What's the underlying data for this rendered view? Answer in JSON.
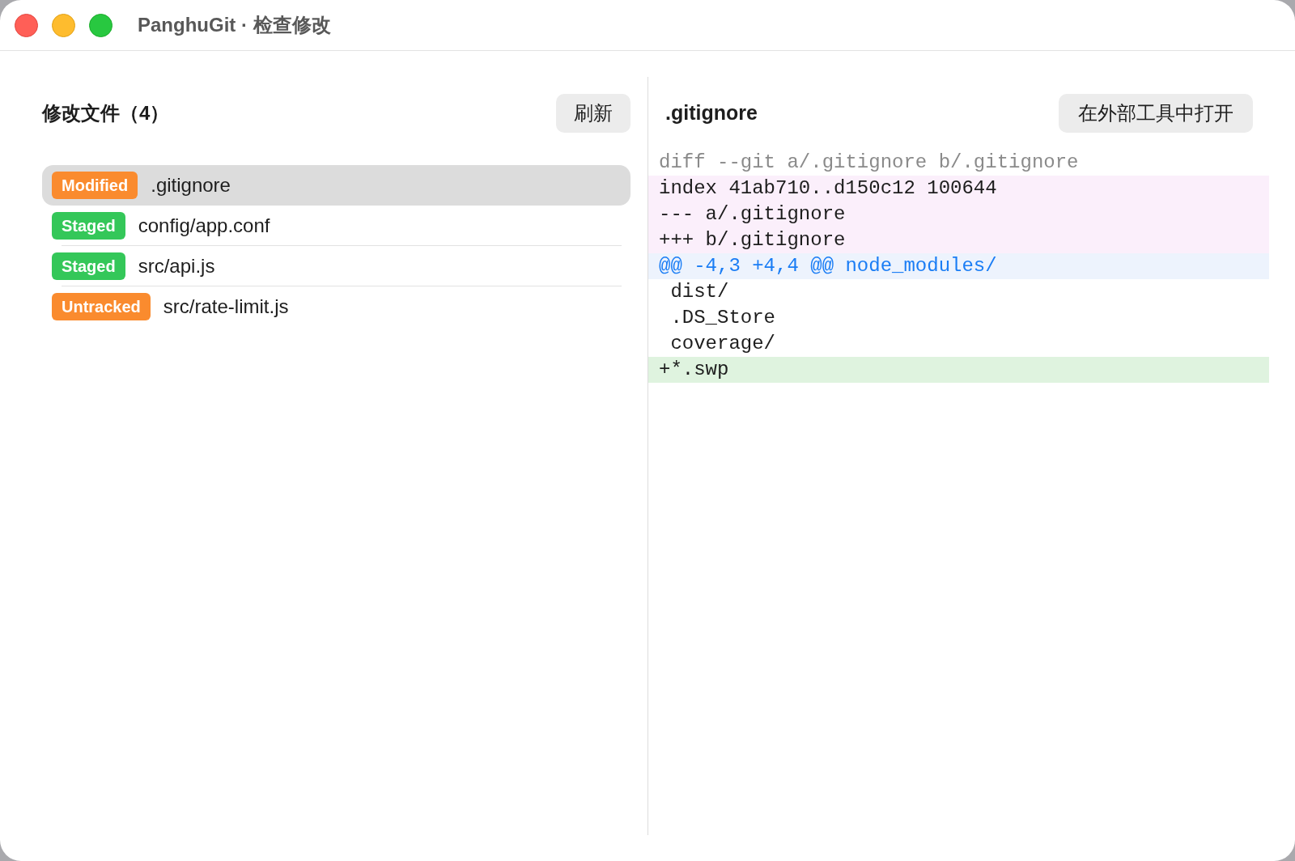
{
  "window": {
    "title": "PanghuGit · 检查修改"
  },
  "file_list": {
    "title": "修改文件（4）",
    "refresh_button": "刷新",
    "items": [
      {
        "status": "Modified",
        "color": "#fa8b2e",
        "path": ".gitignore",
        "selected": true
      },
      {
        "status": "Staged",
        "color": "#34c759",
        "path": "config/app.conf",
        "selected": false
      },
      {
        "status": "Staged",
        "color": "#34c759",
        "path": "src/api.js",
        "selected": false
      },
      {
        "status": "Untracked",
        "color": "#fa8b2e",
        "path": "src/rate-limit.js",
        "selected": false
      }
    ]
  },
  "diff": {
    "title": ".gitignore",
    "open_button": "在外部工具中打开",
    "lines": [
      {
        "kind": "header",
        "text": "diff --git a/.gitignore b/.gitignore"
      },
      {
        "kind": "meta",
        "text": "index 41ab710..d150c12 100644"
      },
      {
        "kind": "meta",
        "text": "--- a/.gitignore"
      },
      {
        "kind": "meta",
        "text": "+++ b/.gitignore"
      },
      {
        "kind": "hunk",
        "text": "@@ -4,3 +4,4 @@ node_modules/"
      },
      {
        "kind": "context",
        "text": " dist/"
      },
      {
        "kind": "context",
        "text": " .DS_Store"
      },
      {
        "kind": "context",
        "text": " coverage/"
      },
      {
        "kind": "added",
        "text": "+*.swp"
      }
    ]
  }
}
